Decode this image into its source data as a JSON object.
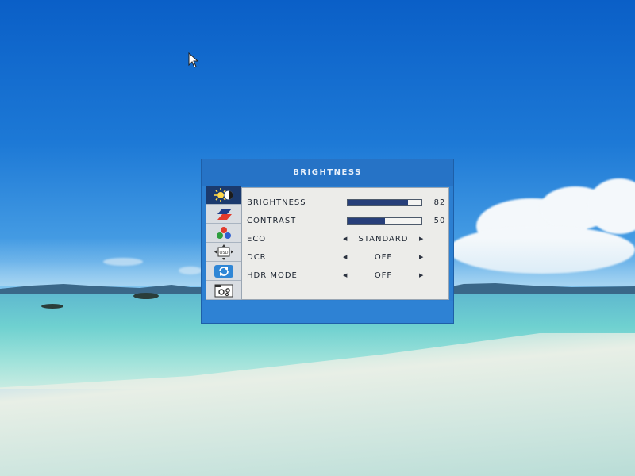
{
  "osd": {
    "title": "BRIGHTNESS",
    "tabs": [
      {
        "icon": "brightness-icon",
        "active": true
      },
      {
        "icon": "color-image-icon",
        "active": false
      },
      {
        "icon": "color-rgb-icon",
        "active": false
      },
      {
        "icon": "osd-position-icon",
        "active": false
      },
      {
        "icon": "reset-icon",
        "active": false
      },
      {
        "icon": "settings-icon",
        "active": false
      }
    ],
    "rows": [
      {
        "label": "BRIGHTNESS",
        "type": "slider",
        "value": 82
      },
      {
        "label": "CONTRAST",
        "type": "slider",
        "value": 50
      },
      {
        "label": "ECO",
        "type": "option",
        "value": "STANDARD"
      },
      {
        "label": "DCR",
        "type": "option",
        "value": "OFF"
      },
      {
        "label": "HDR MODE",
        "type": "option",
        "value": "OFF"
      }
    ],
    "colors": {
      "header": "#2673c6",
      "active_tab": "#1b3a6e",
      "bar_fill": "#273f7a",
      "panel": "#ecece9"
    }
  }
}
